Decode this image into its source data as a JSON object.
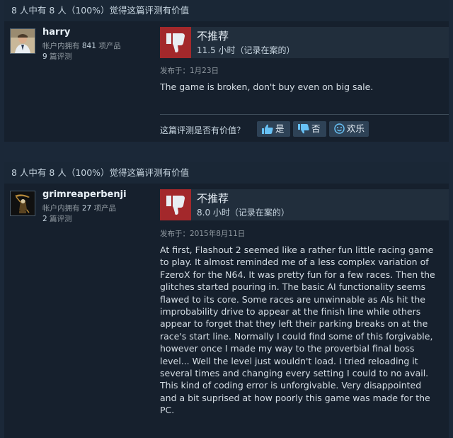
{
  "colors": {
    "background": "#1b2838",
    "card": "#16202d",
    "not_recommended": "#a3282b",
    "vote_button": "#2e4256"
  },
  "reviews": [
    {
      "helpful_text": "8 人中有 8 人（100%）觉得这篇评测有价值",
      "user": {
        "name": "harry",
        "owned_prefix": "帐户内拥有",
        "owned_count": "841",
        "owned_suffix": "项产品",
        "reviews_count": "9",
        "reviews_suffix": "篇评测",
        "avatar_icon": "person-avatar"
      },
      "verdict": "不推荐",
      "verdict_icon": "thumbs-down-icon",
      "hours": "11.5 小时（记录在案的）",
      "posted": "发布于：1月23日",
      "body": "The game is broken, don't buy even on big sale.",
      "helpful_question": "这篇评测是否有价值？",
      "buttons": {
        "yes": "是",
        "no": "否",
        "funny": "欢乐"
      }
    },
    {
      "helpful_text": "8 人中有 8 人（100%）觉得这篇评测有价值",
      "user": {
        "name": "grimreaperbenji",
        "owned_prefix": "帐户内拥有",
        "owned_count": "27",
        "owned_suffix": "项产品",
        "reviews_count": "2",
        "reviews_suffix": "篇评测",
        "avatar_icon": "grim-reaper-avatar"
      },
      "verdict": "不推荐",
      "verdict_icon": "thumbs-down-icon",
      "hours": "8.0 小时（记录在案的）",
      "posted": "发布于：2015年8月11日",
      "body": "At first, Flashout 2 seemed like a rather fun little racing game to play. It almost reminded me of a less complex variation of FzeroX for the N64. It was pretty fun for a few races. Then the glitches started pouring in. The basic AI functionality seems flawed to its core. Some races are unwinnable as AIs hit the improbability drive to appear at the finish line while others appear to forget that they left their parking breaks on at the race's start line. Normally I could find some of this forgivable, however once I made my way to the proverbial final boss level... Well the level just wouldn't load. I tried reloading it several times and changing every setting I could to no avail. This kind of coding error is unforgivable. Very disappointed and a bit suprised at how poorly this game was made for the PC."
    }
  ]
}
